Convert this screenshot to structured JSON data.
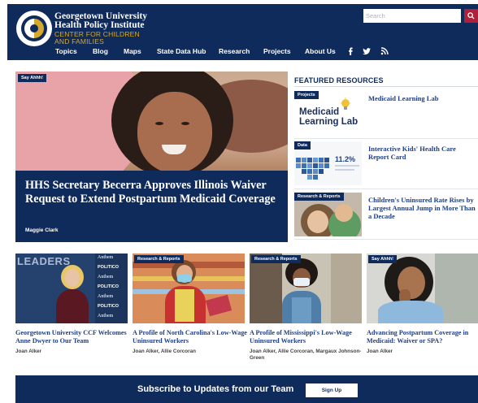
{
  "header": {
    "org_name_line1": "Georgetown University",
    "org_name_line2": "Health Policy Institute",
    "center_line1": "CENTER FOR CHILDREN",
    "center_line2": "AND FAMILIES",
    "search_placeholder": "Search",
    "nav": [
      "Topics",
      "Blog",
      "Maps",
      "State Data Hub",
      "Research",
      "Projects",
      "About Us"
    ],
    "social_icons": [
      "facebook-icon",
      "twitter-icon",
      "rss-icon"
    ]
  },
  "hero": {
    "tag": "Say Ahhh!",
    "title": "HHS Secretary Becerra Approves Illinois Waiver Request to Extend Postpartum Medicaid Coverage",
    "author": "Maggie Clark"
  },
  "featured": {
    "heading": "FEATURED RESOURCES",
    "items": [
      {
        "tag": "Projects",
        "title": "Medicaid Learning Lab",
        "thumb_text_1": "Medicaid",
        "thumb_text_2": "Learning Lab"
      },
      {
        "tag": "Data",
        "title": "Interactive Kids' Health Care Report Card",
        "thumb_stat": "11.2%"
      },
      {
        "tag": "Research & Reports",
        "title": "Children's Uninsured Rate Rises by Largest Annual Jump in More Than a Decade"
      }
    ]
  },
  "cards": [
    {
      "title": "Georgetown University CCF Welcomes Anne Dwyer to Our Team",
      "author": "Joan Alker",
      "backdrop": [
        "LEADERS",
        "Anthem",
        "POLITICO",
        "Anthem",
        "POLITICO",
        "Anthem",
        "POLITICO",
        "Anthem"
      ]
    },
    {
      "tag": "Research & Reports",
      "title": "A Profile of North Carolina's Low-Wage Uninsured Workers",
      "author": "Joan Alker, Allie Corcoran"
    },
    {
      "tag": "Research & Reports",
      "title": "A Profile of Mississippi's Low-Wage Uninsured Workers",
      "author": "Joan Alker, Allie Corcoran, Margaux Johnson-Green"
    },
    {
      "tag": "Say Ahhh!",
      "title": "Advancing Postpartum Coverage in Medicaid: Waiver or SPA?",
      "author": "Joan Alker"
    }
  ],
  "subscribe": {
    "text": "Subscribe to Updates from our Team",
    "button": "Sign Up"
  },
  "colors": {
    "navy": "#0f2b5b",
    "gold": "#d7a82e",
    "link": "#1e3f86",
    "search_red": "#b11f3a"
  }
}
